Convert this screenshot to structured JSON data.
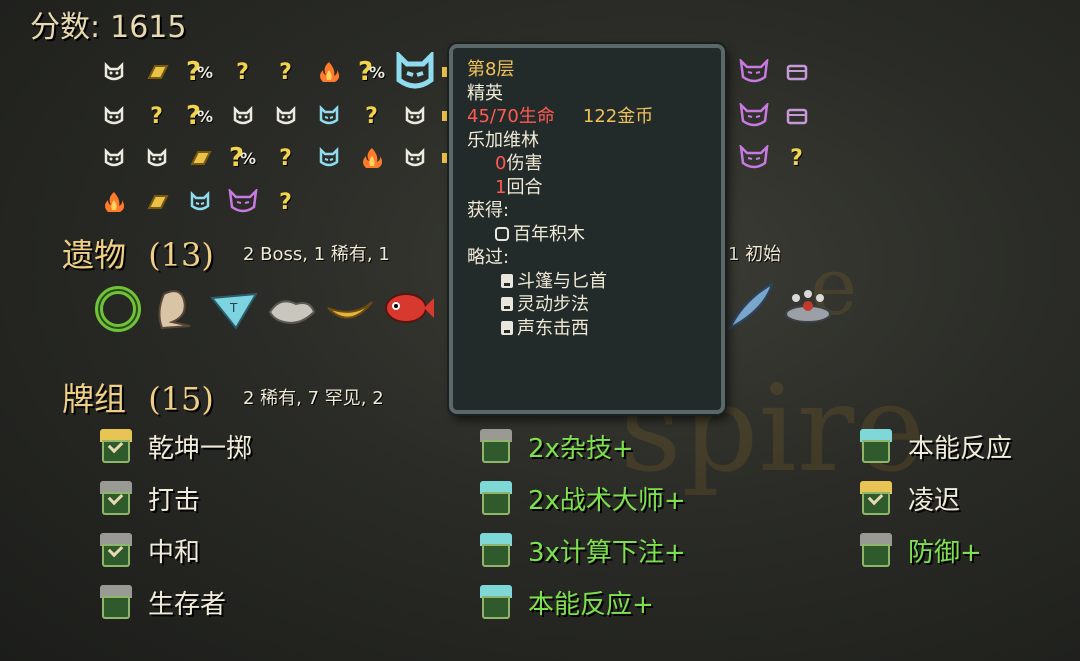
{
  "score": {
    "label": "分数:",
    "value": "1615"
  },
  "map": {
    "rows": [
      [
        "monster",
        "gold-bar",
        "shop-unknown",
        "unknown",
        "unknown",
        "campfire",
        "shop-unknown",
        "elite-big",
        "chest-partial",
        "boss",
        "chest"
      ],
      [
        "monster",
        "unknown",
        "shop-unknown",
        "monster",
        "monster",
        "elite",
        "unknown",
        "monster",
        "chest-partial",
        "boss",
        "chest"
      ],
      [
        "monster",
        "monster",
        "gold-bar",
        "shop-unknown",
        "unknown",
        "elite",
        "campfire",
        "monster",
        "chest-partial",
        "boss",
        "unknown"
      ],
      [
        "campfire",
        "gold-bar",
        "elite",
        "boss",
        "unknown"
      ]
    ],
    "glyph_question": "?",
    "glyph_shop_q": "?",
    "glyph_percent": "%"
  },
  "relics_section": {
    "title": "遗物",
    "count": "(13)",
    "summary_left": "2  Boss, 1  稀有, 1",
    "summary_right": "1  初始"
  },
  "relics": [
    "ring",
    "idol",
    "ice-pyramid",
    "rag",
    "banana",
    "fish",
    "feather",
    "pin-cushion"
  ],
  "deck_section": {
    "title": "牌组",
    "count": "(15)",
    "summary": "2  稀有, 7  罕见, 2"
  },
  "deck": {
    "col1": [
      {
        "name": "乾坤一掷",
        "upgraded": false,
        "rarity": "rare"
      },
      {
        "name": "打击",
        "upgraded": false,
        "rarity": "common"
      },
      {
        "name": "中和",
        "upgraded": false,
        "rarity": "common"
      },
      {
        "name": "生存者",
        "upgraded": false,
        "rarity": "basic"
      }
    ],
    "col2": [
      {
        "name": "2x杂技+",
        "upgraded": true,
        "rarity": "common"
      },
      {
        "name": "2x战术大师+",
        "upgraded": true,
        "rarity": "uncommon"
      },
      {
        "name": "3x计算下注+",
        "upgraded": true,
        "rarity": "uncommon"
      },
      {
        "name": "本能反应+",
        "upgraded": true,
        "rarity": "uncommon"
      }
    ],
    "col3": [
      {
        "name": "本能反应",
        "upgraded": false,
        "rarity": "uncommon"
      },
      {
        "name": "凌迟",
        "upgraded": false,
        "rarity": "rare"
      },
      {
        "name": "防御+",
        "upgraded": true,
        "rarity": "basic"
      }
    ]
  },
  "tooltip": {
    "floor": "第8层",
    "room_type": "精英",
    "hp": "45/70生命",
    "gold": "122金币",
    "enemy": "乐加维林",
    "damage_num": "0",
    "damage_label": "伤害",
    "turns_num": "1",
    "turns_label": "回合",
    "obtained_label": "获得:",
    "obtained_relic": "百年积木",
    "skipped_label": "略过:",
    "skipped": [
      "斗篷与匕首",
      "灵动步法",
      "声东击西"
    ]
  },
  "colors": {
    "card_upgraded": "#7de04f",
    "card_normal": "#f0ead8",
    "hp": "#ff5a52",
    "gold": "#efc15a",
    "section_title": "#efcf86"
  }
}
